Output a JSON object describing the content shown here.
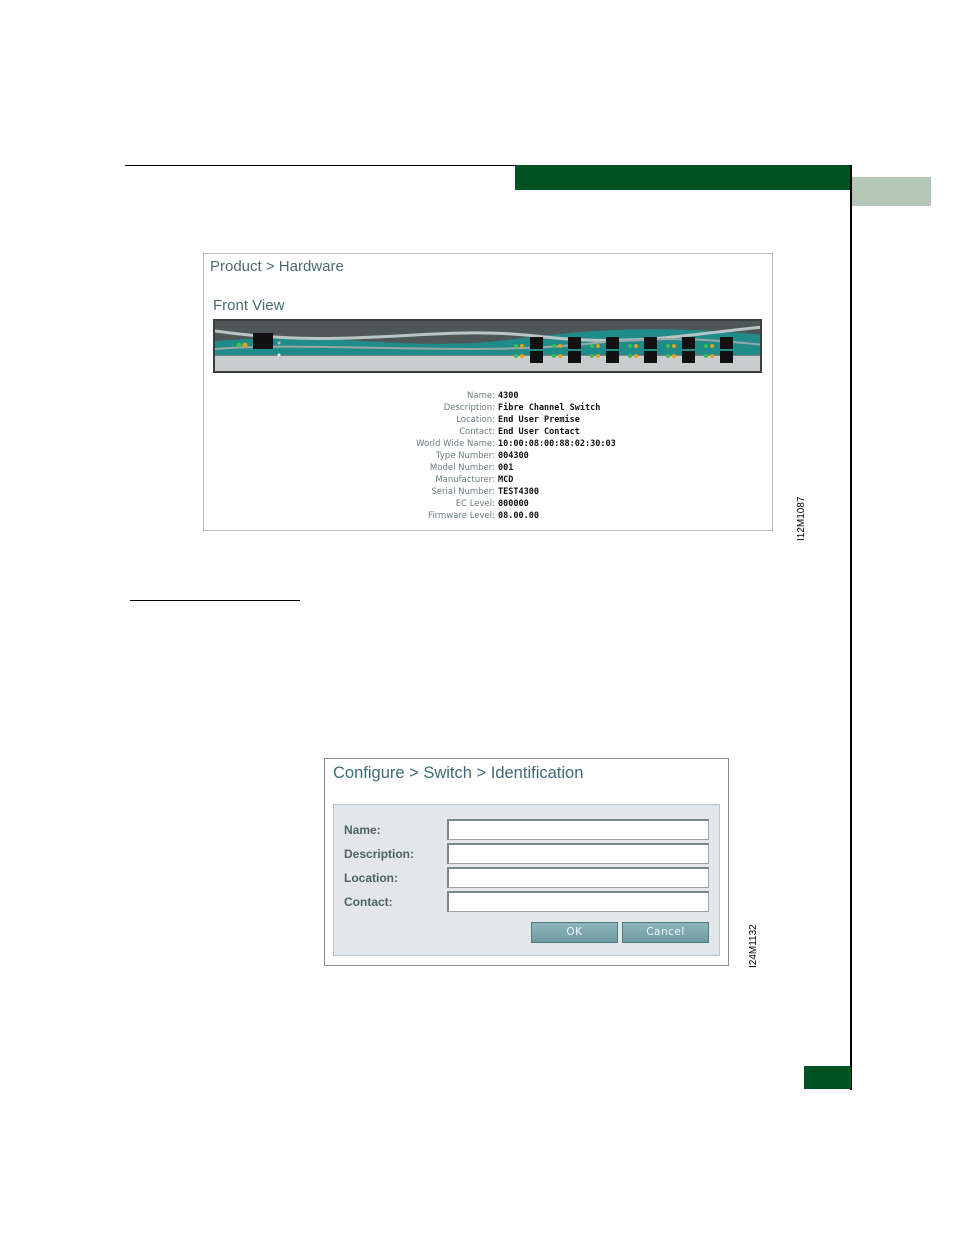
{
  "figure1": {
    "breadcrumb": "Product > Hardware",
    "section_title": "Front View",
    "figure_id": "I12M1087",
    "properties": [
      {
        "label": "Name:",
        "value": "4300"
      },
      {
        "label": "Description:",
        "value": "Fibre Channel Switch"
      },
      {
        "label": "Location:",
        "value": "End User Premise"
      },
      {
        "label": "Contact:",
        "value": "End User Contact"
      },
      {
        "label": "World Wide Name:",
        "value": "10:00:08:00:88:02:30:03"
      },
      {
        "label": "Type Number:",
        "value": "004300"
      },
      {
        "label": "Model Number:",
        "value": "001"
      },
      {
        "label": "Manufacturer:",
        "value": "MCD"
      },
      {
        "label": "Serial Number:",
        "value": "TEST4300"
      },
      {
        "label": "EC Level:",
        "value": "000000"
      },
      {
        "label": "Firmware Level:",
        "value": "08.00.00"
      }
    ]
  },
  "figure2": {
    "breadcrumb": "Configure > Switch > Identification",
    "figure_id": "I24M1132",
    "fields": [
      {
        "label": "Name:",
        "value": ""
      },
      {
        "label": "Description:",
        "value": ""
      },
      {
        "label": "Location:",
        "value": ""
      },
      {
        "label": "Contact:",
        "value": ""
      }
    ],
    "ok_label": "OK",
    "cancel_label": "Cancel"
  },
  "colors": {
    "header_green": "#005124",
    "tab_gray_green": "#b5c8b8",
    "title_teal": "#4b6b6e",
    "button_teal": "#7aa8ae"
  }
}
